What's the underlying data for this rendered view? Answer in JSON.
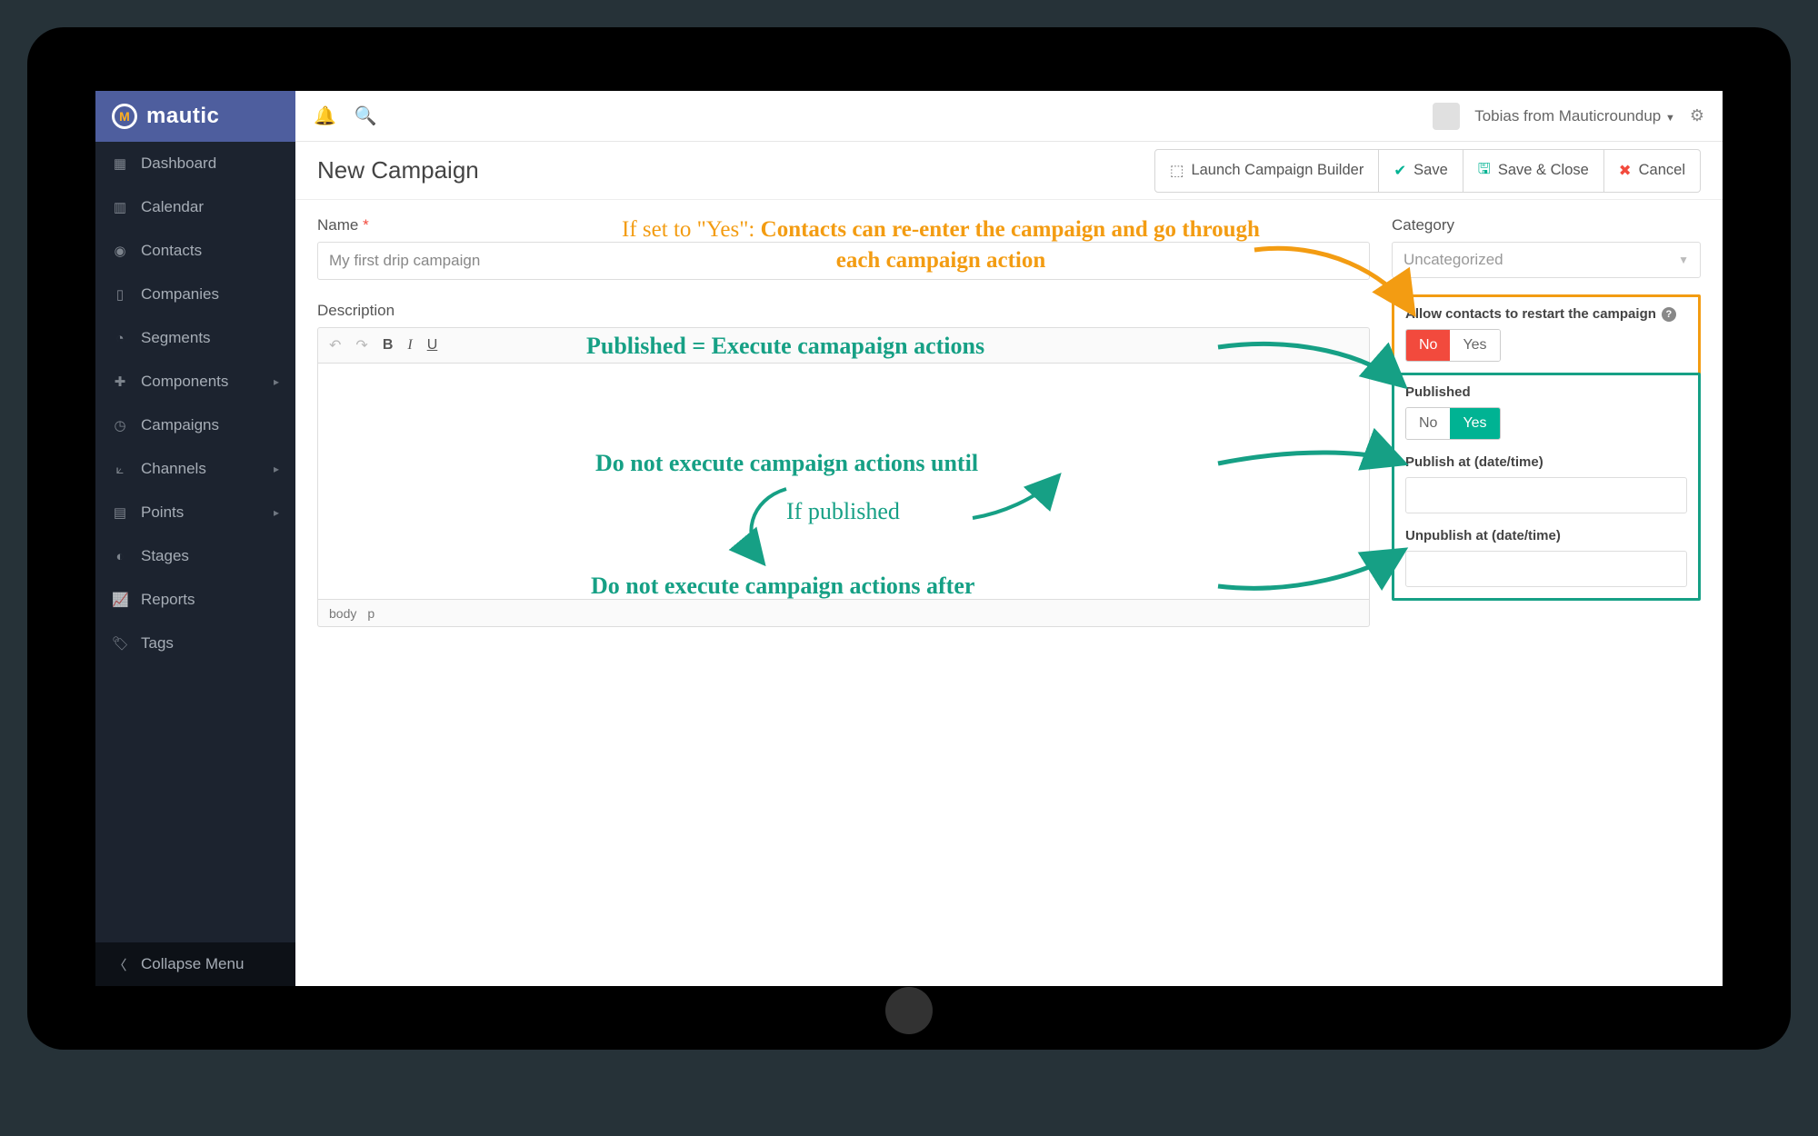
{
  "brand": {
    "name": "mautic"
  },
  "user": {
    "display": "Tobias from Mauticroundup"
  },
  "sidebar": {
    "items": [
      {
        "label": "Dashboard"
      },
      {
        "label": "Calendar"
      },
      {
        "label": "Contacts"
      },
      {
        "label": "Companies"
      },
      {
        "label": "Segments"
      },
      {
        "label": "Components",
        "expandable": true
      },
      {
        "label": "Campaigns"
      },
      {
        "label": "Channels",
        "expandable": true
      },
      {
        "label": "Points",
        "expandable": true
      },
      {
        "label": "Stages"
      },
      {
        "label": "Reports"
      },
      {
        "label": "Tags"
      }
    ],
    "collapse_label": "Collapse Menu"
  },
  "page": {
    "title": "New Campaign",
    "buttons": {
      "builder": "Launch Campaign Builder",
      "save": "Save",
      "save_close": "Save & Close",
      "cancel": "Cancel"
    }
  },
  "form": {
    "name_label": "Name",
    "name_value": "My first drip campaign",
    "description_label": "Description",
    "editor_path_body": "body",
    "editor_path_p": "p",
    "category_label": "Category",
    "category_value": "Uncategorized",
    "restart_label": "Allow contacts to restart the campaign",
    "restart_no": "No",
    "restart_yes": "Yes",
    "published_label": "Published",
    "published_no": "No",
    "published_yes": "Yes",
    "publish_at_label": "Publish at (date/time)",
    "unpublish_at_label": "Unpublish at (date/time)"
  },
  "annotations": {
    "restart_prefix": "If set to \"Yes\": ",
    "restart_bold": "Contacts can re-enter the campaign and go through each campaign action",
    "published": "Published = Execute camapaign actions",
    "publish_at": "Do not execute campaign actions until",
    "if_published": "If published",
    "unpublish_at": "Do not execute campaign actions after"
  }
}
